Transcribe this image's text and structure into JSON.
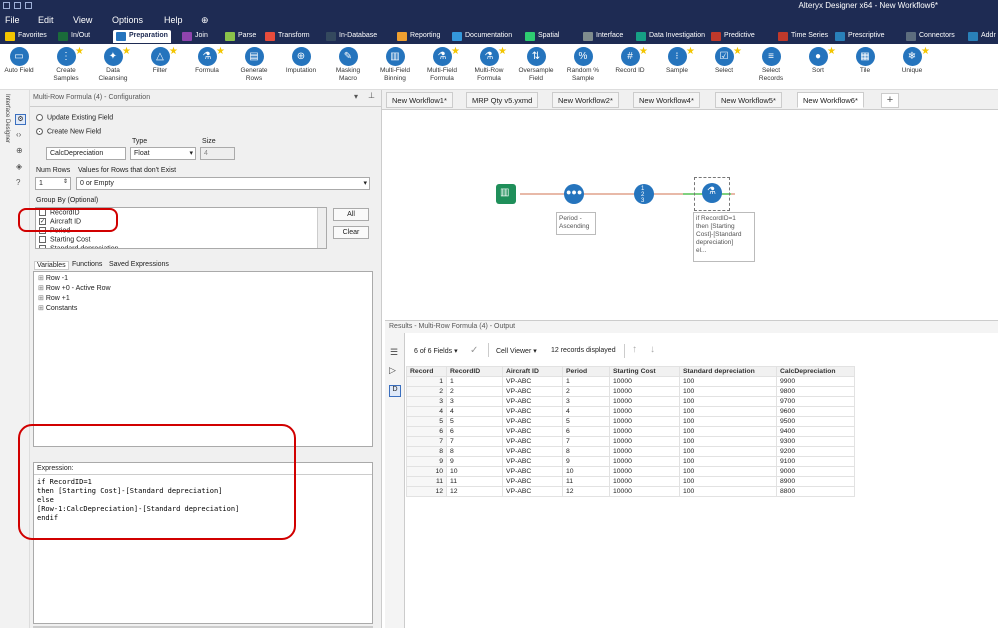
{
  "app_title": "Alteryx Designer x64 - New Workflow6*",
  "menu": [
    "File",
    "Edit",
    "View",
    "Options",
    "Help"
  ],
  "tool_tabs": [
    {
      "label": "Favorites",
      "color": "#f3c500"
    },
    {
      "label": "In/Out",
      "color": "#1a6b3a"
    },
    {
      "label": "Preparation",
      "color": "#2574bd"
    },
    {
      "label": "Join",
      "color": "#8e44ad"
    },
    {
      "label": "Parse",
      "color": "#8bc34a"
    },
    {
      "label": "Transform",
      "color": "#e74c3c"
    },
    {
      "label": "In-Database",
      "color": "#34495e"
    },
    {
      "label": "Reporting",
      "color": "#f0a030"
    },
    {
      "label": "Documentation",
      "color": "#3498db"
    },
    {
      "label": "Spatial",
      "color": "#2ecc71"
    },
    {
      "label": "Interface",
      "color": "#7f8c8d"
    },
    {
      "label": "Data Investigation",
      "color": "#16a085"
    },
    {
      "label": "Predictive",
      "color": "#c0392b"
    },
    {
      "label": "Time Series",
      "color": "#c0392b"
    },
    {
      "label": "Prescriptive",
      "color": "#2980b9"
    },
    {
      "label": "Connectors",
      "color": "#5d6d7e"
    },
    {
      "label": "Addr",
      "color": "#2980b9"
    }
  ],
  "tools": [
    {
      "label": "Auto Field",
      "color": "#2574bd",
      "icon": "auto-field-icon",
      "glyph": "▭",
      "star": false
    },
    {
      "label": "Create Samples",
      "color": "#2574bd",
      "icon": "create-samples-icon",
      "glyph": "⋮",
      "star": true
    },
    {
      "label": "Data Cleansing",
      "color": "#2574bd",
      "icon": "data-cleansing-icon",
      "glyph": "✦",
      "star": true
    },
    {
      "label": "Filter",
      "color": "#2574bd",
      "icon": "filter-icon",
      "glyph": "△",
      "star": true
    },
    {
      "label": "Formula",
      "color": "#2574bd",
      "icon": "formula-icon",
      "glyph": "⚗",
      "star": true
    },
    {
      "label": "Generate Rows",
      "color": "#2574bd",
      "icon": "generate-rows-icon",
      "glyph": "▤",
      "star": false
    },
    {
      "label": "Imputation",
      "color": "#2574bd",
      "icon": "imputation-icon",
      "glyph": "⊕",
      "star": false
    },
    {
      "label": "Masking Macro",
      "color": "#2574bd",
      "icon": "masking-macro-icon",
      "glyph": "✎",
      "star": false
    },
    {
      "label": "Multi-Field Binning",
      "color": "#2574bd",
      "icon": "multi-field-binning-icon",
      "glyph": "▥",
      "star": false
    },
    {
      "label": "Multi-Field Formula",
      "color": "#2574bd",
      "icon": "multi-field-formula-icon",
      "glyph": "⚗",
      "star": true
    },
    {
      "label": "Multi-Row Formula",
      "color": "#2574bd",
      "icon": "multi-row-formula-icon",
      "glyph": "⚗",
      "star": true
    },
    {
      "label": "Oversample Field",
      "color": "#2574bd",
      "icon": "oversample-field-icon",
      "glyph": "⇅",
      "star": false
    },
    {
      "label": "Random % Sample",
      "color": "#2574bd",
      "icon": "random-sample-icon",
      "glyph": "%",
      "star": false
    },
    {
      "label": "Record ID",
      "color": "#2574bd",
      "icon": "record-id-icon",
      "glyph": "#",
      "star": true
    },
    {
      "label": "Sample",
      "color": "#2574bd",
      "icon": "sample-icon",
      "glyph": "⁝",
      "star": true
    },
    {
      "label": "Select",
      "color": "#2574bd",
      "icon": "select-icon",
      "glyph": "☑",
      "star": true
    },
    {
      "label": "Select Records",
      "color": "#2574bd",
      "icon": "select-records-icon",
      "glyph": "≡",
      "star": false
    },
    {
      "label": "Sort",
      "color": "#2574bd",
      "icon": "sort-icon",
      "glyph": "●",
      "star": true
    },
    {
      "label": "Tile",
      "color": "#2574bd",
      "icon": "tile-icon",
      "glyph": "▦",
      "star": false
    },
    {
      "label": "Unique",
      "color": "#2574bd",
      "icon": "unique-icon",
      "glyph": "❄",
      "star": true
    }
  ],
  "side_strip_label": "Interface Designer",
  "config": {
    "title": "Multi-Row Formula (4) - Configuration",
    "update_existing": "Update Existing Field",
    "create_new": "Create New  Field",
    "field_name": "CalcDepreciation",
    "type_label": "Type",
    "type_value": "Float",
    "size_label": "Size",
    "size_value": "4",
    "num_rows_label": "Num Rows",
    "num_rows_value": "1",
    "values_label": "Values for Rows that don't Exist",
    "values_value": "0 or Empty",
    "group_by_label": "Group By (Optional)",
    "group_fields": [
      {
        "label": "RecordID",
        "checked": false
      },
      {
        "label": "Aircraft ID",
        "checked": true
      },
      {
        "label": "Period",
        "checked": false
      },
      {
        "label": "Starting Cost",
        "checked": false
      },
      {
        "label": "Standard depreciation",
        "checked": false
      }
    ],
    "all_button": "All",
    "clear_button": "Clear",
    "var_tabs": [
      "Variables",
      "Functions",
      "Saved Expressions"
    ],
    "var_tree": [
      "Row -1",
      "Row +0 - Active Row",
      "Row +1",
      "Constants"
    ],
    "expression_label": "Expression:",
    "expression": "if RecordID=1\nthen [Starting Cost]-[Standard depreciation]\nelse\n[Row-1:CalcDepreciation]-[Standard depreciation]\nendif"
  },
  "doc_tabs": [
    "New Workflow1*",
    "MRP Qty v5.yxmd",
    "New Workflow2*",
    "New Workflow4*",
    "New Workflow5*",
    "New Workflow6*"
  ],
  "canvas": {
    "sort_annotation": "Period -\nAscending",
    "formula_annotation": "if RecordID=1\nthen [Starting\nCost]-[Standard\ndepreciation]\nel..."
  },
  "results": {
    "title": "Results - Multi-Row Formula (4) - Output",
    "fields_label": "6 of 6 Fields",
    "viewer_label": "Cell Viewer",
    "records_label": "12 records displayed",
    "columns": [
      "Record",
      "RecordID",
      "Aircraft ID",
      "Period",
      "Starting Cost",
      "Standard depreciation",
      "CalcDepreciation"
    ],
    "rows": [
      [
        "1",
        "1",
        "VP-ABC",
        "1",
        "10000",
        "100",
        "9900"
      ],
      [
        "2",
        "2",
        "VP-ABC",
        "2",
        "10000",
        "100",
        "9800"
      ],
      [
        "3",
        "3",
        "VP-ABC",
        "3",
        "10000",
        "100",
        "9700"
      ],
      [
        "4",
        "4",
        "VP-ABC",
        "4",
        "10000",
        "100",
        "9600"
      ],
      [
        "5",
        "5",
        "VP-ABC",
        "5",
        "10000",
        "100",
        "9500"
      ],
      [
        "6",
        "6",
        "VP-ABC",
        "6",
        "10000",
        "100",
        "9400"
      ],
      [
        "7",
        "7",
        "VP-ABC",
        "7",
        "10000",
        "100",
        "9300"
      ],
      [
        "8",
        "8",
        "VP-ABC",
        "8",
        "10000",
        "100",
        "9200"
      ],
      [
        "9",
        "9",
        "VP-ABC",
        "9",
        "10000",
        "100",
        "9100"
      ],
      [
        "10",
        "10",
        "VP-ABC",
        "10",
        "10000",
        "100",
        "9000"
      ],
      [
        "11",
        "11",
        "VP-ABC",
        "11",
        "10000",
        "100",
        "8900"
      ],
      [
        "12",
        "12",
        "VP-ABC",
        "12",
        "10000",
        "100",
        "8800"
      ]
    ]
  }
}
